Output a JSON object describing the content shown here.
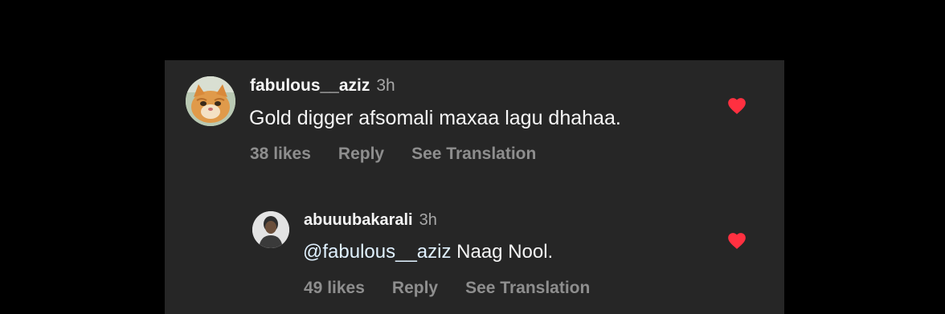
{
  "comments": [
    {
      "username": "fabulous__aziz",
      "time": "3h",
      "text": "Gold digger afsomali maxaa lagu dhahaa.",
      "likes": "38 likes",
      "reply": "Reply",
      "translate": "See Translation",
      "liked": true
    },
    {
      "username": "abuuubakarali",
      "time": "3h",
      "mention": "@fabulous__aziz",
      "text": " Naag Nool.",
      "likes": "49 likes",
      "reply": "Reply",
      "translate": "See Translation",
      "liked": true
    }
  ],
  "colors": {
    "background": "#000000",
    "panel": "#262626",
    "heart": "#ff3040",
    "primary_text": "#f5f5f5",
    "secondary_text": "#8e8e8e"
  }
}
